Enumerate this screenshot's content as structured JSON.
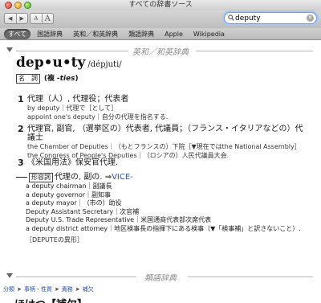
{
  "window": {
    "title": "すべての辞書ソース"
  },
  "toolbar": {
    "back_glyph": "◀",
    "forward_glyph": "▶",
    "font_small": "A",
    "font_large": "A",
    "search_value": "deputy"
  },
  "scopes": [
    "すべて",
    "国語辞典",
    "英和／和英辞典",
    "類語辞典",
    "Apple",
    "Wikipedia"
  ],
  "sections": {
    "eiwa": "英和／和英辞典",
    "ruigo": "類語辞典"
  },
  "entry": {
    "headword": "dep•u•ty",
    "pronunciation": "/dépjuti/",
    "pos": "名　詞",
    "plural_prefix": "(複",
    "plural_form": "-ties",
    "plural_suffix": ")"
  },
  "senses": [
    {
      "num": "1",
      "main": "代理（人）, 代理役；代表者",
      "examples": [
        "by deputy｜代理で［として］",
        "appoint one's deputy｜自分の代理を指名する."
      ]
    },
    {
      "num": "2",
      "main": "代理官, 副官, （選挙区の）代表者, 代議員；（フランス・イタリアなどの）代議士",
      "examples": [
        "the Chamber of Deputies｜（もとフランスの）下院［▼現在ではthe National Assembly］",
        "the Congress of People's Deputies｜（ロシアの）人民代議員大会."
      ]
    },
    {
      "num": "3",
      "main": "《米国用法》保安官代理.",
      "examples": []
    }
  ],
  "derivative": {
    "box": "形容詞",
    "lead": "代理の, 副の. ⇒",
    "link": "VICE-",
    "examples": [
      "a deputy chairman｜副議長",
      "a deputy governor｜副知事",
      "a deputy mayor｜（市の）助役",
      "Deputy Assistant Secretary｜次官補",
      "Deputy U.S. Trade Representative｜米国通商代表部次席代表",
      "a deputy district attorney｜地区検事長の指揮下にある検事（▼「検事補」と訳さないこと）."
    ],
    "note": "［DEPUTEの異形］"
  },
  "breadcrumb": [
    "分類",
    "事柄・性質",
    "責務",
    "補欠"
  ],
  "next_heading": "ほけつ【補欠】"
}
